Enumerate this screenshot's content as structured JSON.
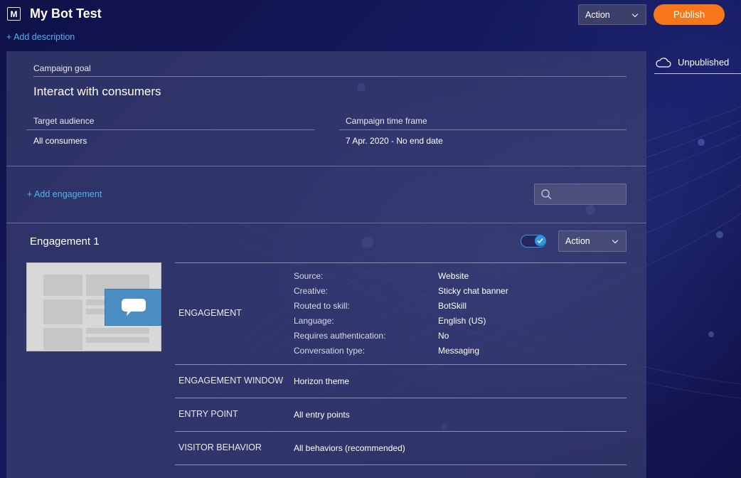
{
  "header": {
    "logo_letter": "M",
    "title": "My Bot Test",
    "add_description": "+ Add description",
    "action_label": "Action",
    "publish_label": "Publish"
  },
  "status": {
    "icon": "cloud-icon",
    "label": "Unpublished"
  },
  "campaign": {
    "goal_label": "Campaign goal",
    "goal_value": "Interact with consumers",
    "audience_label": "Target audience",
    "audience_value": "All consumers",
    "timeframe_label": "Campaign time frame",
    "timeframe_value": "7 Apr. 2020 - No end date"
  },
  "engagements_bar": {
    "add_label": "+  Add engagement",
    "search_placeholder": ""
  },
  "engagement": {
    "title": "Engagement 1",
    "enabled": true,
    "action_label": "Action",
    "section_engagement": "ENGAGEMENT",
    "details": [
      {
        "key": "Source:",
        "value": "Website"
      },
      {
        "key": "Creative:",
        "value": "Sticky chat banner"
      },
      {
        "key": "Routed to skill:",
        "value": "BotSkill"
      },
      {
        "key": "Language:",
        "value": "English (US)"
      },
      {
        "key": "Requires authentication:",
        "value": "No"
      },
      {
        "key": "Conversation type:",
        "value": "Messaging"
      }
    ],
    "window_label": "ENGAGEMENT WINDOW",
    "window_value": "Horizon theme",
    "entry_label": "ENTRY POINT",
    "entry_value": "All entry points",
    "behavior_label": "VISITOR BEHAVIOR",
    "behavior_value": "All behaviors (recommended)"
  },
  "colors": {
    "accent": "#4fb3f1",
    "publish": "#f7751b",
    "toggle": "#2e97e0"
  }
}
